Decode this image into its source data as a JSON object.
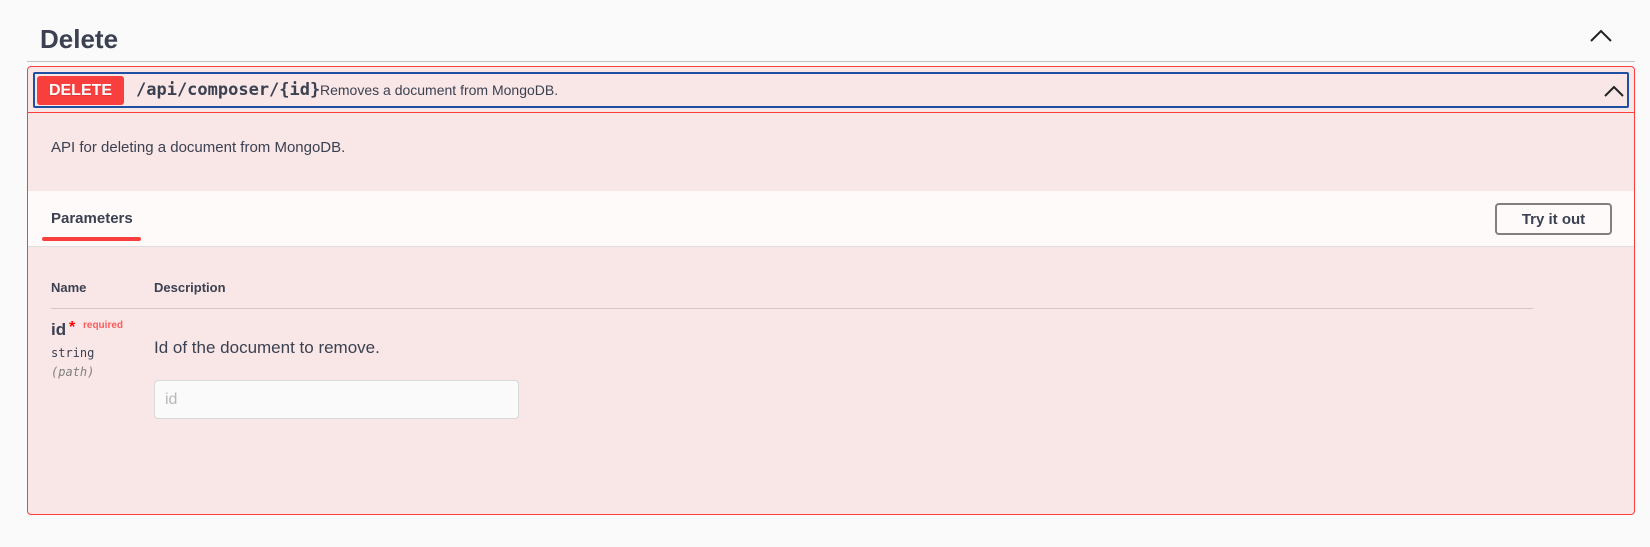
{
  "tag": {
    "title": "Delete",
    "collapse_icon": "chevron-up-icon"
  },
  "operation": {
    "method": "DELETE",
    "path": "/api/composer/{id}",
    "summary": "Removes a document from MongoDB.",
    "description": "API for deleting a document from MongoDB.",
    "collapse_icon": "chevron-up-icon",
    "colors": {
      "method": "#f93e3e",
      "background": "#feebeb",
      "focus_outline": "#1f4fa3"
    }
  },
  "parameters": {
    "tab_label": "Parameters",
    "try_label": "Try it out",
    "columns": {
      "name": "Name",
      "description": "Description"
    },
    "items": [
      {
        "name": "id",
        "required_marker": "*",
        "required_label": "required",
        "type": "string",
        "in": "(path)",
        "description": "Id of the document to remove.",
        "placeholder": "id",
        "value": ""
      }
    ]
  }
}
